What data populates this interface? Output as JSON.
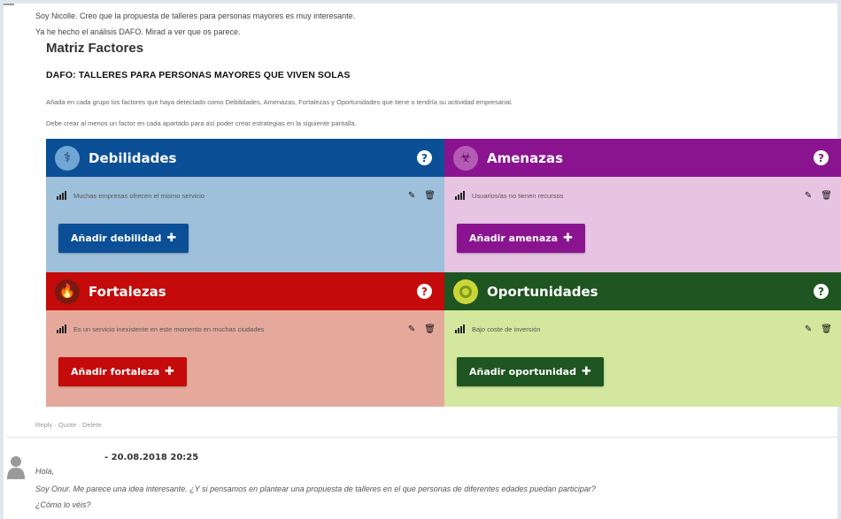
{
  "post": {
    "line1": "Soy Nicolle. Creo que la propuesta de talleres para personas mayores es muy interesante.",
    "line2": "Ya he hecho el análisis DAFO. Mirad a ver que os parece."
  },
  "matrix": {
    "title": "Matriz Factores",
    "heading": "DAFO: TALLERES PARA PERSONAS MAYORES QUE VIVEN SOLAS",
    "instruction1": "Añada en cada grupo los factores que haya detectado como Debilidades, Amenazas, Fortalezas y Oportunidades que tiene o tendría su actividad empresarial.",
    "instruction2": "Debe crear al menos un factor en cada apartado para así poder crear estrategias en la siguiente pantalla.",
    "help_glyph": "?",
    "debilidades": {
      "title": "Debilidades",
      "item": "Muchas empresas ofrecen el mismo servicio",
      "button": "Añadir debilidad",
      "header_color": "#0b4f96",
      "body_color": "#9ec0da"
    },
    "amenazas": {
      "title": "Amenazas",
      "item": "Usuarios/as no tienen recursos",
      "button": "Añadir amenaza",
      "header_color": "#8a1490",
      "body_color": "#e8c4e3"
    },
    "fortalezas": {
      "title": "Fortalezas",
      "item": "Es un servicio inexistente en este momento en muchas ciudades",
      "button": "Añadir fortaleza",
      "header_color": "#c40a0a",
      "body_color": "#e5a99c"
    },
    "oportunidades": {
      "title": "Oportunidades",
      "item": "Bajo coste de inversión",
      "button": "Añadir oportunidad",
      "header_color": "#1e5520",
      "body_color": "#d3e89e"
    }
  },
  "actions": {
    "text": "Reply · Quote · Delete"
  },
  "comment": {
    "date": "- 20.08.2018 20:25",
    "greeting": "Hola,",
    "body1": "Soy Onur. Me parece una idea interesante. ¿Y si pensamos en plantear una propuesta de talleres en el que personas de diferentes edades puedan participar?",
    "body2": "¿Cómo lo véis?"
  },
  "icons": {
    "debilidades": "pulse-symbol-icon",
    "amenazas": "biohazard-icon",
    "fortalezas": "flame-icon",
    "oportunidades": "target-ring-icon",
    "edit": "pencil-icon",
    "delete": "trash-icon",
    "strength": "signal-bars-icon",
    "add": "plus-icon",
    "avatar": "user-silhouette-icon"
  }
}
